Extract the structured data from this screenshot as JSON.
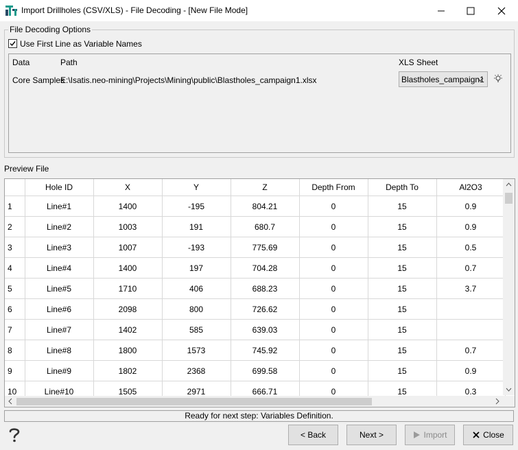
{
  "window": {
    "title": "Import Drillholes (CSV/XLS) - File Decoding - [New File Mode]",
    "app_icon": "isatis-app-icon"
  },
  "decoding": {
    "group_title": "File Decoding Options",
    "use_first_line_label": "Use First Line as Variable Names",
    "use_first_line_checked": true,
    "headers": {
      "data": "Data",
      "path": "Path",
      "xls_sheet": "XLS Sheet"
    },
    "row": {
      "data": "Core Samples",
      "path": "E:\\Isatis.neo-mining\\Projects\\Mining\\public\\Blastholes_campaign1.xlsx",
      "sheet": "Blastholes_campaign1"
    }
  },
  "preview": {
    "label": "Preview File",
    "columns": [
      "Hole ID",
      "X",
      "Y",
      "Z",
      "Depth From",
      "Depth To",
      "Al2O3"
    ],
    "rows": [
      [
        "1",
        "Line#1",
        "1400",
        "-195",
        "804.21",
        "0",
        "15",
        "0.9"
      ],
      [
        "2",
        "Line#2",
        "1003",
        "191",
        "680.7",
        "0",
        "15",
        "0.9"
      ],
      [
        "3",
        "Line#3",
        "1007",
        "-193",
        "775.69",
        "0",
        "15",
        "0.5"
      ],
      [
        "4",
        "Line#4",
        "1400",
        "197",
        "704.28",
        "0",
        "15",
        "0.7"
      ],
      [
        "5",
        "Line#5",
        "1710",
        "406",
        "688.23",
        "0",
        "15",
        "3.7"
      ],
      [
        "6",
        "Line#6",
        "2098",
        "800",
        "726.62",
        "0",
        "15",
        ""
      ],
      [
        "7",
        "Line#7",
        "1402",
        "585",
        "639.03",
        "0",
        "15",
        ""
      ],
      [
        "8",
        "Line#8",
        "1800",
        "1573",
        "745.92",
        "0",
        "15",
        "0.7"
      ],
      [
        "9",
        "Line#9",
        "1802",
        "2368",
        "699.58",
        "0",
        "15",
        "0.9"
      ],
      [
        "10",
        "Line#10",
        "1505",
        "2971",
        "666.71",
        "0",
        "15",
        "0.3"
      ]
    ]
  },
  "status": {
    "text": "Ready for next step: Variables Definition."
  },
  "buttons": {
    "back": "< Back",
    "next": "Next >",
    "import": "Import",
    "close": "Close",
    "help_icon": "help-icon"
  }
}
